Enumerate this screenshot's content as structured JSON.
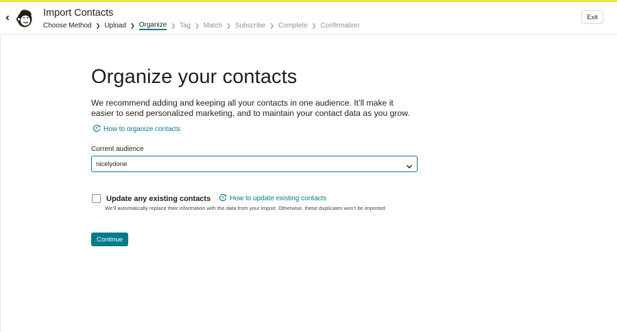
{
  "header": {
    "title": "Import Contacts",
    "exit_label": "Exit",
    "breadcrumb": [
      {
        "label": "Choose Method",
        "state": "done"
      },
      {
        "label": "Upload",
        "state": "done"
      },
      {
        "label": "Organize",
        "state": "active"
      },
      {
        "label": "Tag",
        "state": "disabled"
      },
      {
        "label": "Match",
        "state": "disabled"
      },
      {
        "label": "Subscribe",
        "state": "disabled"
      },
      {
        "label": "Complete",
        "state": "disabled"
      },
      {
        "label": "Confirmation",
        "state": "disabled"
      }
    ]
  },
  "main": {
    "title": "Organize your contacts",
    "intro": "We recommend adding and keeping all your contacts in one audience. It’ll make it easier to send personalized marketing, and to maintain your contact data as you grow.",
    "help_link_organize": "How to organize contacts",
    "audience_label": "Current audience",
    "audience_value": "nicelydone",
    "update_checkbox_label": "Update any existing contacts",
    "update_checkbox_checked": false,
    "help_link_update": "How to update existing contacts",
    "update_description": "We’ll automatically replace their information with the data from your import. Otherwise, these duplicates won’t be imported.",
    "continue_label": "Continue"
  },
  "colors": {
    "accent": "#007c89",
    "top_bar": "#f0e14a",
    "text": "#241c15",
    "disabled_text": "#8f8f8f"
  },
  "icons": {
    "back": "chevron-left-icon",
    "logo": "mailchimp-freddie-logo",
    "help": "help-circle-icon",
    "dropdown": "chevron-down-icon"
  }
}
